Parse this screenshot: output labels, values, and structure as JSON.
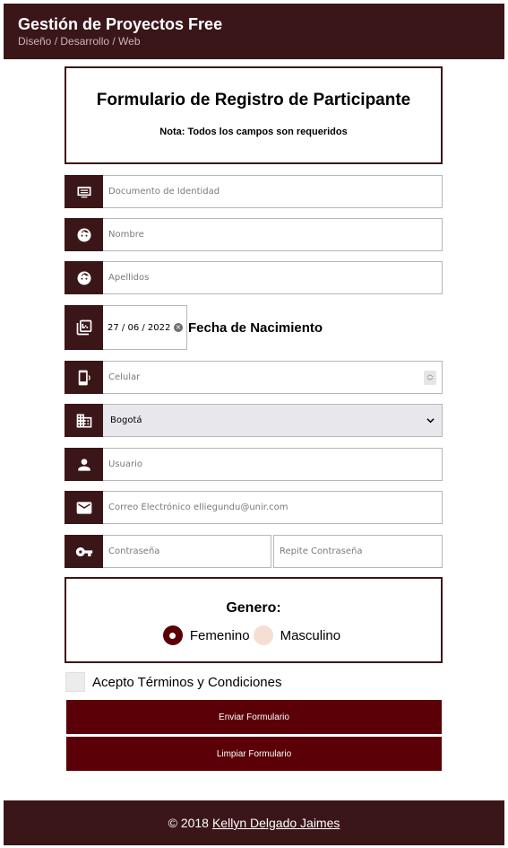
{
  "header": {
    "title": "Gestión de Proyectos Free",
    "subtitle": "Diseño / Desarrollo / Web"
  },
  "form": {
    "title": "Formulario de Registro de Participante",
    "note": "Nota: Todos los campos son requeridos",
    "fields": {
      "documento": {
        "placeholder": "Documento de Identidad",
        "icon": "id-card-icon"
      },
      "nombre": {
        "placeholder": "Nombre",
        "icon": "face-icon"
      },
      "apellidos": {
        "placeholder": "Apellidos",
        "icon": "face-icon"
      },
      "fecha": {
        "value": "27 / 06 / 2022",
        "label": "Fecha de Nacimiento",
        "icon": "calendar-plus-icon"
      },
      "celular": {
        "placeholder": "Celular",
        "icon": "phone-icon"
      },
      "ciudad": {
        "value": "Bogotá",
        "icon": "city-icon"
      },
      "usuario": {
        "placeholder": "Usuario",
        "icon": "person-icon"
      },
      "correo": {
        "placeholder": "Correo Electrónico elliegundu@unir.com",
        "icon": "mail-icon"
      },
      "contrasena": {
        "placeholder": "Contraseña",
        "icon": "key-icon"
      },
      "repite_contrasena": {
        "placeholder": "Repite Contraseña"
      }
    },
    "genero": {
      "title": "Genero:",
      "options": [
        {
          "label": "Femenino",
          "checked": true
        },
        {
          "label": "Masculino",
          "checked": false
        }
      ]
    },
    "terms_label": "Acepto Términos y Condiciones",
    "submit_label": "Enviar Formulario",
    "reset_label": "Limpiar Formulario"
  },
  "footer": {
    "copyright": "© 2018",
    "author": "Kellyn Delgado Jaimes"
  },
  "colors": {
    "header_bg": "#3b1618",
    "button_bg": "#5a0006",
    "radio_checked": "#5a0006",
    "radio_unchecked": "#f5dfd2"
  }
}
